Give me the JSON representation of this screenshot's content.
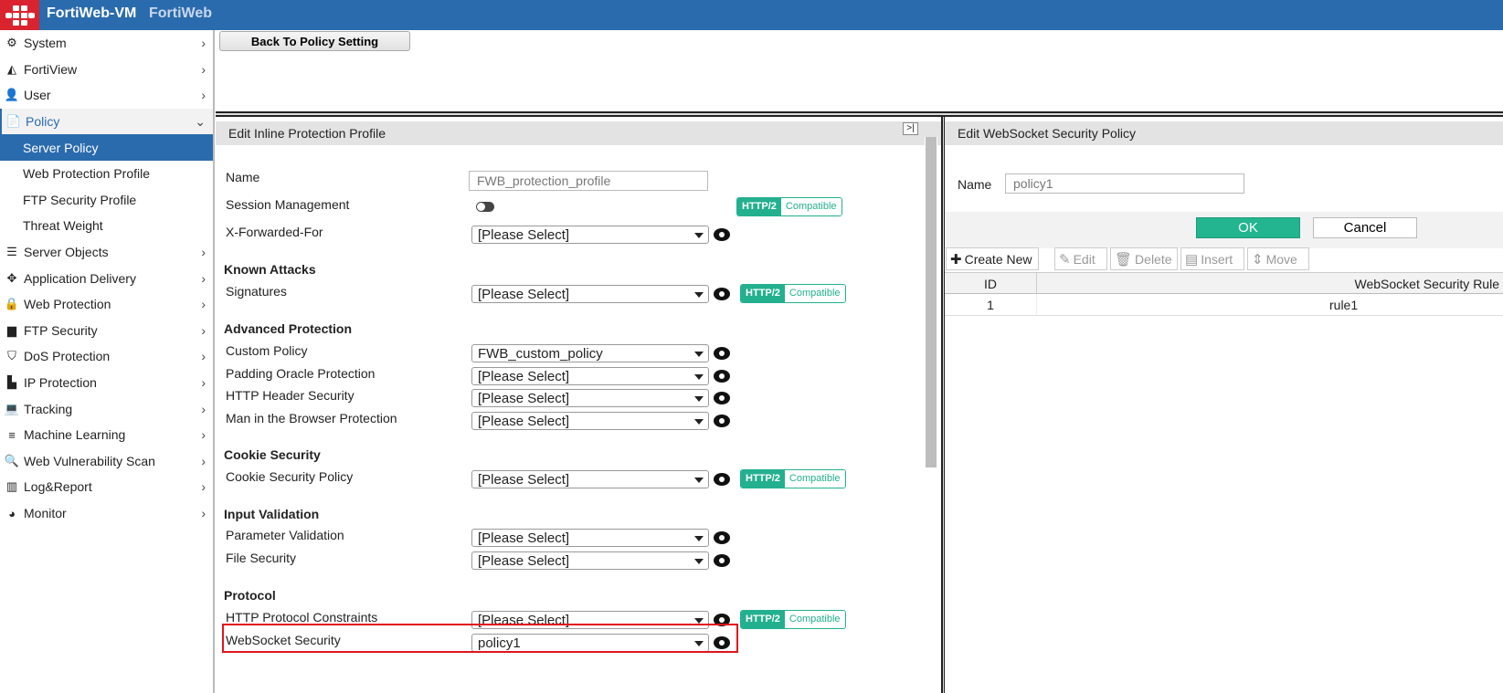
{
  "header": {
    "title": "FortiWeb-VM",
    "subtitle": "FortiWeb"
  },
  "sidebar": {
    "items": [
      {
        "label": "System",
        "icon": "gear-icon",
        "glyph": "⚙"
      },
      {
        "label": "FortiView",
        "icon": "chart-area-icon",
        "glyph": "◭"
      },
      {
        "label": "User",
        "icon": "user-icon",
        "glyph": "👤"
      },
      {
        "label": "Policy",
        "icon": "policy-icon",
        "glyph": "📄"
      },
      {
        "label": "Server Policy"
      },
      {
        "label": "Web Protection Profile"
      },
      {
        "label": "FTP Security Profile"
      },
      {
        "label": "Threat Weight"
      },
      {
        "label": "Server Objects",
        "icon": "server-icon",
        "glyph": "☰"
      },
      {
        "label": "Application Delivery",
        "icon": "arrows-icon",
        "glyph": "✥"
      },
      {
        "label": "Web Protection",
        "icon": "lock-icon",
        "glyph": "🔒"
      },
      {
        "label": "FTP Security",
        "icon": "folder-icon",
        "glyph": "▆"
      },
      {
        "label": "DoS Protection",
        "icon": "shield-icon",
        "glyph": "⛉"
      },
      {
        "label": "IP Protection",
        "icon": "ip-icon",
        "glyph": "▙"
      },
      {
        "label": "Tracking",
        "icon": "laptop-icon",
        "glyph": "💻"
      },
      {
        "label": "Machine Learning",
        "icon": "menu-icon",
        "glyph": "≡"
      },
      {
        "label": "Web Vulnerability Scan",
        "icon": "search-icon",
        "glyph": "🔍"
      },
      {
        "label": "Log&Report",
        "icon": "bar-chart-icon",
        "glyph": "▥"
      },
      {
        "label": "Monitor",
        "icon": "pie-chart-icon",
        "glyph": "◕"
      }
    ]
  },
  "back_button": "Back To Policy Setting",
  "left_panel": {
    "title": "Edit Inline Protection Profile",
    "collapse": ">|",
    "name_label": "Name",
    "name_value": "FWB_protection_profile",
    "session_label": "Session Management",
    "badge": {
      "a": "HTTP/2",
      "b": "Compatible"
    },
    "rows": [
      {
        "label": "X-Forwarded-For",
        "value": "[Please Select]"
      },
      {
        "heading": "Known Attacks"
      },
      {
        "label": "Signatures",
        "value": "[Please Select]"
      },
      {
        "heading": "Advanced Protection"
      },
      {
        "label": "Custom Policy",
        "value": "FWB_custom_policy"
      },
      {
        "label": "Padding Oracle Protection",
        "value": "[Please Select]"
      },
      {
        "label": "HTTP Header Security",
        "value": "[Please Select]"
      },
      {
        "label": "Man in the Browser Protection",
        "value": "[Please Select]"
      },
      {
        "heading": "Cookie Security"
      },
      {
        "label": "Cookie Security Policy",
        "value": "[Please Select]"
      },
      {
        "heading": "Input Validation"
      },
      {
        "label": "Parameter Validation",
        "value": "[Please Select]"
      },
      {
        "label": "File Security",
        "value": "[Please Select]"
      },
      {
        "heading": "Protocol"
      },
      {
        "label": "HTTP Protocol Constraints",
        "value": "[Please Select]"
      },
      {
        "label": "WebSocket Security",
        "value": "policy1"
      }
    ]
  },
  "right_panel": {
    "title": "Edit WebSocket Security Policy",
    "name_label": "Name",
    "name_value": "policy1",
    "ok": "OK",
    "cancel": "Cancel",
    "toolbar": {
      "create": "Create New",
      "edit": "Edit",
      "delete": "Delete",
      "insert": "Insert",
      "move": "Move"
    },
    "columns": [
      "ID",
      "WebSocket Security Rule"
    ],
    "rows": [
      {
        "id": "1",
        "rule": "rule1"
      }
    ]
  }
}
